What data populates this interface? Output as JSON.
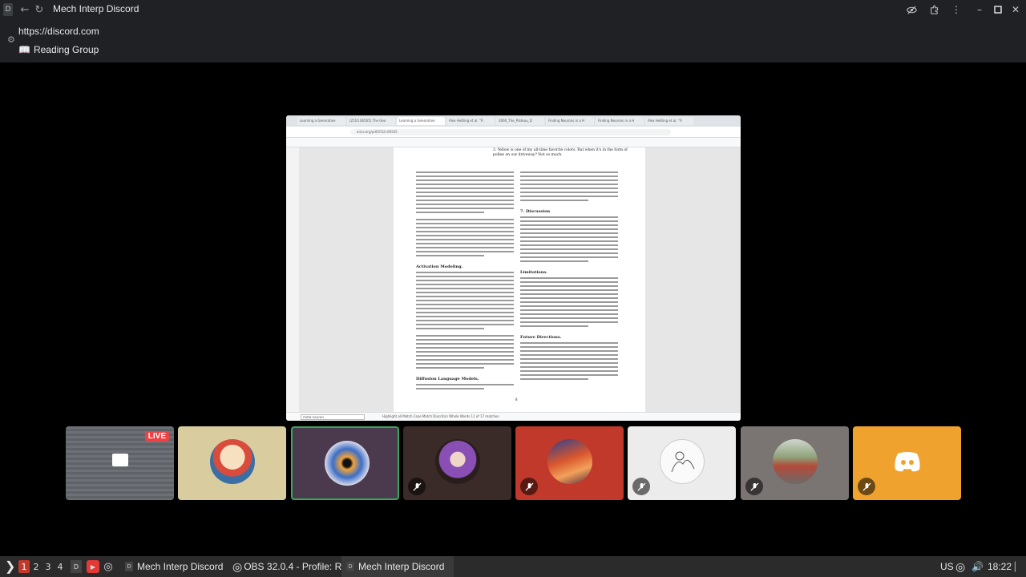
{
  "window": {
    "app_badge": "D",
    "title": "Mech Interp Discord"
  },
  "browser": {
    "url": "https://discord.com",
    "channel_emoji": "📖",
    "channel_name": "Reading Group"
  },
  "stream": {
    "tabs": [
      "Learning a Generative",
      "[2510.06505] The Geo",
      "Learning a Generative",
      "Alex Heßling et al. \"Fi",
      "2060_The_Plateau_D",
      "Finding Neurons in a H",
      "Finding Neurons in a H",
      "Alex Heßling et al. \"Fi"
    ],
    "address": "arxiv.org/pdf/2510.06505",
    "page_top_text": "3. Yellow is one of my all-time favorite colors. But when it's in the form of pollen on our driveway? Not so much.",
    "headings": {
      "discussion": "7. Discussion",
      "activation_modeling": "Activation Modeling.",
      "limitations": "Limitations.",
      "future_directions": "Future Directions.",
      "diffusion_language_models": "Diffusion Language Models."
    },
    "page_number": "8",
    "find_placeholder": "meta-neuron",
    "find_options": "Highlight all   Match Case   Match Diacritics   Whole Words   11 of 17 matches"
  },
  "participants": [
    {
      "name": "screen-share",
      "live": "LIVE",
      "bg": "#5f6368"
    },
    {
      "name": "cartoon-avatar",
      "bg": "#d9cda0",
      "muted": false
    },
    {
      "name": "swirl-avatar",
      "bg": "#4b3a4e",
      "muted": false,
      "speaking": true
    },
    {
      "name": "anime-avatar",
      "bg": "#3a2a28",
      "muted": true
    },
    {
      "name": "sunset-avatar",
      "bg": "#c0392b",
      "muted": true
    },
    {
      "name": "sketch-avatar",
      "bg": "#ececec",
      "muted": true
    },
    {
      "name": "photo-avatar",
      "bg": "#7a7472",
      "muted": true
    },
    {
      "name": "discord-default-avatar",
      "bg": "#f0a22e",
      "muted": true
    }
  ],
  "taskbar": {
    "workspaces": [
      "1",
      "2",
      "3",
      "4"
    ],
    "items": [
      {
        "label": "Mech Interp Discord"
      },
      {
        "label": "OBS 32.0.4 - Profile: R..."
      },
      {
        "label": "Mech Interp Discord"
      }
    ],
    "keyboard_layout": "US",
    "clock": "18:22"
  }
}
